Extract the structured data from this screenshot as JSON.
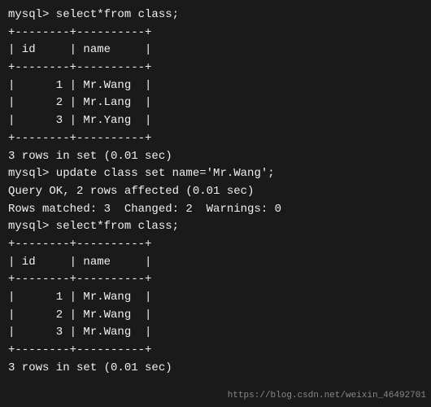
{
  "terminal": {
    "lines": [
      {
        "type": "prompt",
        "text": "mysql> select*from class;"
      },
      {
        "type": "table",
        "text": "+--------+----------+"
      },
      {
        "type": "table",
        "text": "| id     | name     |"
      },
      {
        "type": "table",
        "text": "+--------+----------+"
      },
      {
        "type": "table",
        "text": "|      1 | Mr.Wang  |"
      },
      {
        "type": "table",
        "text": "|      2 | Mr.Lang  |"
      },
      {
        "type": "table",
        "text": "|      3 | Mr.Yang  |"
      },
      {
        "type": "table",
        "text": "+--------+----------+"
      },
      {
        "type": "info",
        "text": "3 rows in set (0.01 sec)"
      },
      {
        "type": "blank",
        "text": ""
      },
      {
        "type": "prompt",
        "text": "mysql> update class set name='Mr.Wang';"
      },
      {
        "type": "info",
        "text": "Query OK, 2 rows affected (0.01 sec)"
      },
      {
        "type": "info",
        "text": "Rows matched: 3  Changed: 2  Warnings: 0"
      },
      {
        "type": "blank",
        "text": ""
      },
      {
        "type": "prompt",
        "text": "mysql> select*from class;"
      },
      {
        "type": "table",
        "text": "+--------+----------+"
      },
      {
        "type": "table",
        "text": "| id     | name     |"
      },
      {
        "type": "table",
        "text": "+--------+----------+"
      },
      {
        "type": "table",
        "text": "|      1 | Mr.Wang  |"
      },
      {
        "type": "table",
        "text": "|      2 | Mr.Wang  |"
      },
      {
        "type": "table",
        "text": "|      3 | Mr.Wang  |"
      },
      {
        "type": "table",
        "text": "+--------+----------+"
      },
      {
        "type": "info",
        "text": "3 rows in set (0.01 sec)"
      }
    ],
    "watermark": "https://blog.csdn.net/weixin_46492701"
  }
}
